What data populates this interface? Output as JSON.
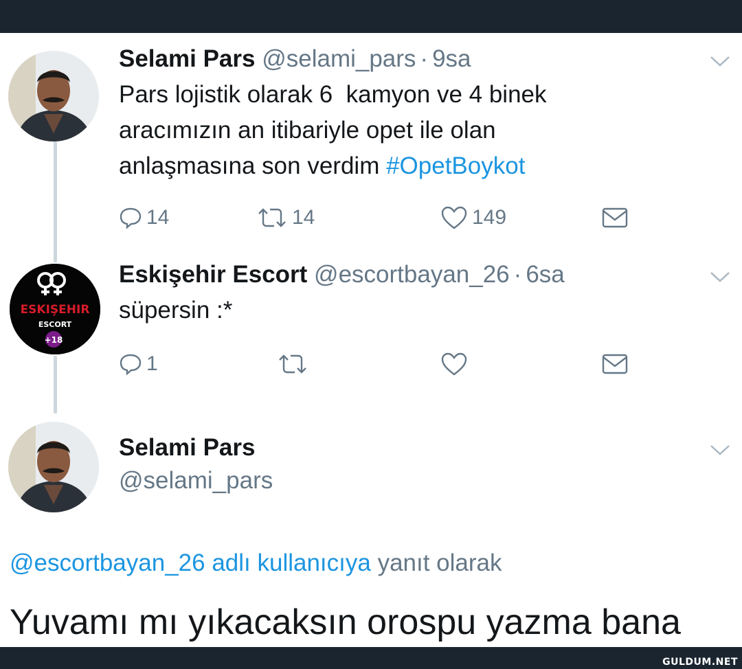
{
  "tweet1": {
    "name": "Selami Pars",
    "handle": "@selami_pars",
    "separator": "·",
    "time": "9sa",
    "text_line1": "Pars lojistik olarak 6  kamyon ve 4 binek",
    "text_line2": "aracımızın an itibariyle opet ile olan",
    "text_line3_plain": "anlaşmasına son verdim",
    "hashtag": "#OpetBoykot",
    "replies": "14",
    "retweets": "14",
    "likes": "149"
  },
  "tweet2": {
    "name": "Eskişehir Escort",
    "handle": "@escortbayan_26",
    "separator": "·",
    "time": "6sa",
    "text": "süpersin :*",
    "replies": "1",
    "avatar_line1": "ESKIŞEHIR",
    "avatar_line2": "ESCORT",
    "avatar_line3": "+18"
  },
  "tweet3": {
    "name": "Selami Pars",
    "handle": "@selami_pars",
    "replying_mention": "@escortbayan_26 adlı kullanıcıya",
    "replying_suffix": "yanıt olarak",
    "text": "Yuvamı mı yıkacaksın orospu yazma bana"
  },
  "watermark": "GULDUM.NET",
  "colors": {
    "accent": "#1b95e0",
    "secondary_text": "#657786",
    "thread_line": "#ccd6dd",
    "frame": "#1b2530"
  },
  "icons": [
    "reply-icon",
    "retweet-icon",
    "like-icon",
    "message-icon",
    "chevron-down-icon"
  ]
}
